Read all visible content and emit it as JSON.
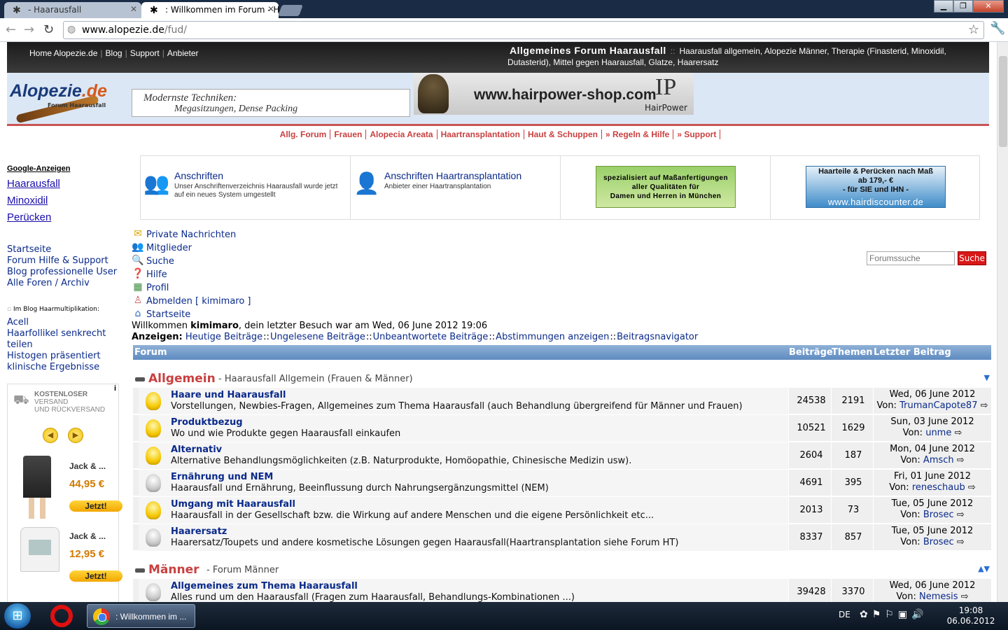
{
  "browser": {
    "tabs": [
      {
        "label": "- Haarausfall"
      },
      {
        "label": ": Willkommen im Forum - H"
      }
    ],
    "url_host": "www.alopezie.de",
    "url_path": "/fud/"
  },
  "topbar": {
    "nav": [
      "Home Alopezie.de",
      "Blog",
      "Support",
      "Anbieter"
    ],
    "title": "Allgemeines Forum Haarausfall",
    "subtitle": "Haarausfall allgemein, Alopezie Männer, Therapie (Finasterid, Minoxidil, Dutasterid), Mittel gegen Haarausfall, Glatze, Haarersatz"
  },
  "header": {
    "logo_main": "Alopezie",
    "logo_tld": ".de",
    "logo_sub": "Forum Haarausfall",
    "ad1_line1": "Modernste Techniken:",
    "ad1_line2": "Megasitzungen, Dense Packing",
    "ad2_url": "www.hairpower-shop.com",
    "ad2_mark": "IP",
    "ad2_brand": "HairPower"
  },
  "catnav": [
    "Allg. Forum",
    "Frauen",
    "Alopecia Areata",
    "Haartransplantation",
    "Haut & Schuppen",
    "» Regeln & Hilfe",
    "» Support"
  ],
  "left": {
    "gads_title": "Google-Anzeigen",
    "gads": [
      "Haarausfall",
      "Minoxidil",
      "Perücken"
    ],
    "links": [
      "Startseite",
      "Forum Hilfe & Support",
      "Blog professionelle User",
      "Alle Foren / Archiv"
    ],
    "blog_heading": "Im Blog Haarmultiplikation:",
    "blog_links": [
      "Acell",
      "Haarfollikel senkrecht teilen",
      "Histogen präsentiert klinische Ergebnisse"
    ],
    "shop": {
      "info": "i",
      "ship_1": "KOSTENLOSER",
      "ship_2": "VERSAND",
      "ship_3": "UND RÜCKVERSAND",
      "products": [
        {
          "name": "Jack & ...",
          "price": "44,95 €",
          "btn": "Jetzt!"
        },
        {
          "name": "Jack & ...",
          "price": "12,95 €",
          "btn": "Jetzt!"
        }
      ]
    }
  },
  "adrow": {
    "a1_title": "Anschriften",
    "a1_desc": "Unser Anschriftenverzeichnis Haarausfall wurde jetzt auf ein neues System umgestellt",
    "a2_title": "Anschriften Haartransplantation",
    "a2_desc": "Anbieter einer Haartransplantation",
    "green_1": "spezialisiert auf Maßanfertigungen",
    "green_2": "aller Qualitäten für",
    "green_3": "Damen und Herren in München",
    "blue_1": "Haarteile & Perücken nach Maß",
    "blue_2": "ab 179,- €",
    "blue_3": "- für SIE und IHN -",
    "blue_url": "www.hairdiscounter.de"
  },
  "usermenu": [
    "Private Nachrichten",
    "Mitglieder",
    "Suche",
    "Hilfe",
    "Profil",
    "Abmelden [ kimimaro ]",
    "Startseite"
  ],
  "search": {
    "placeholder": "Forumssuche",
    "button": "Suche"
  },
  "welcome": {
    "pre": "Willkommen ",
    "user": "kimimaro",
    "post": ", dein letzter Besuch war am Wed, 06 June 2012 19:06"
  },
  "anzeigen": {
    "label": "Anzeigen:",
    "links": [
      "Heutige Beiträge",
      "Ungelesene Beiträge",
      "Unbeantwortete Beiträge",
      "Abstimmungen anzeigen",
      "Beitragsnavigator"
    ]
  },
  "table_header": {
    "forum": "Forum",
    "posts": "Beiträge",
    "topics": "Themen",
    "last": "Letzter Beitrag"
  },
  "categories": [
    {
      "name": "Allgemein",
      "desc": "- Haarausfall Allgemein (Frauen & Männer)",
      "forums": [
        {
          "title": "Haare und Haarausfall",
          "desc": "Vorstellungen, Newbies-Fragen, Allgemeines zum Thema Haarausfall (auch Behandlung übergreifend für Männer und Frauen)",
          "posts": "24538",
          "topics": "2191",
          "date": "Wed, 06 June 2012",
          "von": "Von:",
          "user": "TrumanCapote87",
          "bulb": "on"
        },
        {
          "title": "Produktbezug",
          "desc": "Wo und wie Produkte gegen Haarausfall einkaufen",
          "posts": "10521",
          "topics": "1629",
          "date": "Sun, 03 June 2012",
          "von": "Von:",
          "user": "unme",
          "bulb": "on"
        },
        {
          "title": "Alternativ",
          "desc": "Alternative Behandlungsmöglichkeiten (z.B. Naturprodukte, Homöopathie, Chinesische Medizin usw).",
          "posts": "2604",
          "topics": "187",
          "date": "Mon, 04 June 2012",
          "von": "Von:",
          "user": "Amsch",
          "bulb": "on"
        },
        {
          "title": "Ernährung und NEM",
          "desc": "Haarausfall und Ernährung, Beeinflussung durch Nahrungsergänzungsmittel (NEM)",
          "posts": "4691",
          "topics": "395",
          "date": "Fri, 01 June 2012",
          "von": "Von:",
          "user": "reneschaub",
          "bulb": "off"
        },
        {
          "title": "Umgang mit Haarausfall",
          "desc": "Haarausfall in der Gesellschaft bzw. die Wirkung auf andere Menschen und die eigene Persönlichkeit etc...",
          "posts": "2013",
          "topics": "73",
          "date": "Tue, 05 June 2012",
          "von": "Von:",
          "user": "Brosec",
          "bulb": "on"
        },
        {
          "title": "Haarersatz",
          "desc": "Haarersatz/Toupets und andere kosmetische Lösungen gegen Haarausfall(Haartransplantation siehe Forum HT)",
          "posts": "8337",
          "topics": "857",
          "date": "Tue, 05 June 2012",
          "von": "Von:",
          "user": "Brosec",
          "bulb": "off"
        }
      ]
    },
    {
      "name": "Männer",
      "desc": "- Forum Männer",
      "forums": [
        {
          "title": "Allgemeines zum Thema Haarausfall",
          "desc": "Alles rund um den Haarausfall (Fragen zum Haarausfall, Behandlungs-Kombinationen ...)",
          "posts": "39428",
          "topics": "3370",
          "date": "Wed, 06 June 2012",
          "von": "Von:",
          "user": "Nemesis",
          "bulb": "off"
        }
      ]
    }
  ],
  "taskbar": {
    "task_label": ": Willkommen im ...",
    "lang": "DE",
    "time": "19:08",
    "date": "06.06.2012"
  }
}
